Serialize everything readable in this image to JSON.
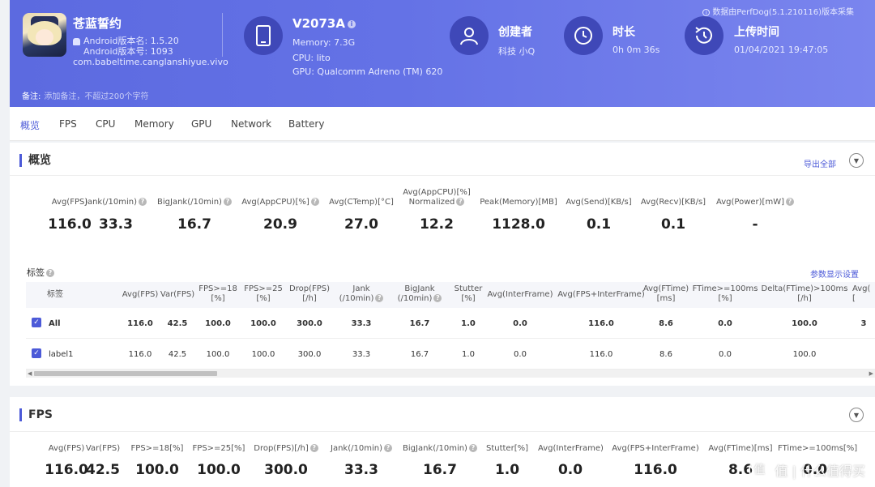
{
  "header": {
    "app_name": "苍蓝誓约",
    "android_version_name": "Android版本名: 1.5.20",
    "android_version_code": "Android版本号: 1093",
    "package": "com.babeltime.canglanshiyue.vivo",
    "device": {
      "name": "V2073A",
      "memory": "Memory: 7.3G",
      "cpu": "CPU: lito",
      "gpu": "GPU: Qualcomm Adreno (TM) 620"
    },
    "creator": {
      "title": "创建者",
      "value": "科技 小Q"
    },
    "duration": {
      "title": "时长",
      "value": "0h 0m 36s"
    },
    "upload": {
      "title": "上传时间",
      "value": "01/04/2021 19:47:05"
    },
    "perfdog_note": "数据由PerfDog(5.1.210116)版本采集",
    "remark_label": "备注:",
    "remark_placeholder": "添加备注，不超过200个字符"
  },
  "tabs": [
    "概览",
    "FPS",
    "CPU",
    "Memory",
    "GPU",
    "Network",
    "Battery"
  ],
  "overview": {
    "title": "概览",
    "export_label": "导出全部",
    "metrics": [
      {
        "label": "Avg(FPS)",
        "value": "116.0"
      },
      {
        "label": "Jank(/10min)",
        "value": "33.3"
      },
      {
        "label": "BigJank(/10min)",
        "value": "16.7"
      },
      {
        "label": "Avg(AppCPU)[%]",
        "value": "20.9"
      },
      {
        "label": "Avg(CTemp)[°C]",
        "value": "27.0"
      },
      {
        "label_line1": "Avg(AppCPU)[%]",
        "label_line2": "Normalized",
        "value": "12.2"
      },
      {
        "label": "Peak(Memory)[MB]",
        "value": "1128.0"
      },
      {
        "label": "Avg(Send)[KB/s]",
        "value": "0.1"
      },
      {
        "label": "Avg(Recv)[KB/s]",
        "value": "0.1"
      },
      {
        "label": "Avg(Power)[mW]",
        "value": "-"
      }
    ],
    "tag_label": "标签",
    "param_link": "参数显示设置",
    "table": {
      "headers": [
        {
          "l1": "标签"
        },
        {
          "l1": "Avg(FPS)"
        },
        {
          "l1": "Var(FPS)"
        },
        {
          "l1": "FPS>=18",
          "l2": "[%]"
        },
        {
          "l1": "FPS>=25",
          "l2": "[%]"
        },
        {
          "l1": "Drop(FPS)",
          "l2": "[/h]"
        },
        {
          "l1": "Jank",
          "l2": "(/10min)"
        },
        {
          "l1": "BigJank",
          "l2": "(/10min)"
        },
        {
          "l1": "Stutter",
          "l2": "[%]"
        },
        {
          "l1": "Avg(InterFrame)"
        },
        {
          "l1": "Avg(FPS+InterFrame)"
        },
        {
          "l1": "Avg(FTime)",
          "l2": "[ms]"
        },
        {
          "l1": "FTime>=100ms",
          "l2": "[%]"
        },
        {
          "l1": "Delta(FTime)>100ms",
          "l2": "[/h]"
        },
        {
          "l1": "Avg(",
          "l2": "["
        }
      ],
      "rows": [
        {
          "label": "All",
          "cells": [
            "116.0",
            "42.5",
            "100.0",
            "100.0",
            "300.0",
            "33.3",
            "16.7",
            "1.0",
            "0.0",
            "116.0",
            "8.6",
            "0.0",
            "100.0",
            "3"
          ]
        },
        {
          "label": "label1",
          "cells": [
            "116.0",
            "42.5",
            "100.0",
            "100.0",
            "300.0",
            "33.3",
            "16.7",
            "1.0",
            "0.0",
            "116.0",
            "8.6",
            "0.0",
            "100.0",
            ""
          ]
        }
      ]
    }
  },
  "fps_panel": {
    "title": "FPS",
    "metrics": [
      {
        "label": "Avg(FPS)",
        "value": "116.0"
      },
      {
        "label": "Var(FPS)",
        "value": "42.5"
      },
      {
        "label": "FPS>=18[%]",
        "value": "100.0"
      },
      {
        "label": "FPS>=25[%]",
        "value": "100.0"
      },
      {
        "label": "Drop(FPS)[/h]",
        "value": "300.0"
      },
      {
        "label": "Jank(/10min)",
        "value": "33.3"
      },
      {
        "label": "BigJank(/10min)",
        "value": "16.7"
      },
      {
        "label": "Stutter[%]",
        "value": "1.0"
      },
      {
        "label": "Avg(InterFrame)",
        "value": "0.0"
      },
      {
        "label": "Avg(FPS+InterFrame)",
        "value": "116.0"
      },
      {
        "label": "Avg(FTime)[ms]",
        "value": "8.6"
      },
      {
        "label": "FTime>=100ms[%]",
        "value": "0.0"
      }
    ]
  },
  "watermark": "值 | 什么值得买",
  "colors": {
    "accent": "#4c5ad8",
    "header_start": "#5c6ae0",
    "header_end": "#7a85ee"
  },
  "icons": [
    "phone-icon",
    "user-icon",
    "clock-icon",
    "history-icon",
    "info-icon",
    "help-icon",
    "chevron-down-icon",
    "android-icon"
  ]
}
